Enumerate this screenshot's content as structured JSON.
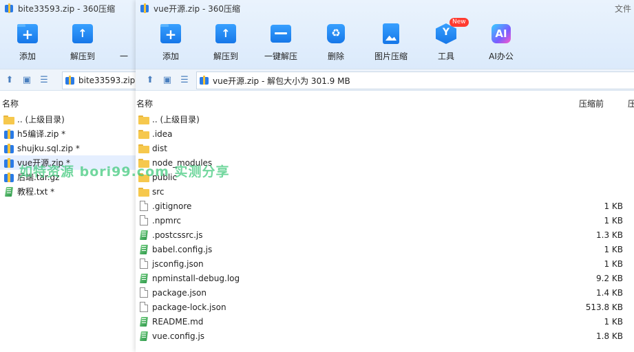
{
  "left_window": {
    "title": "bite33593.zip - 360压缩",
    "toolbar": {
      "add_label": "添加",
      "extract_label": "解压到",
      "overflow_label": "一"
    },
    "path": "bite33593.zip",
    "column_name": "名称",
    "files": [
      {
        "icon": "folder-icon",
        "name": ".. (上级目录)"
      },
      {
        "icon": "zip-icon",
        "name": "h5编译.zip *"
      },
      {
        "icon": "zip-icon",
        "name": "shujku.sql.zip *"
      },
      {
        "icon": "zip-icon",
        "name": "vue开源.zip *"
      },
      {
        "icon": "zip-icon",
        "name": "后端.tar.gz"
      },
      {
        "icon": "script-icon",
        "name": "教程.txt *"
      }
    ]
  },
  "right_window": {
    "title": "vue开源.zip - 360压缩",
    "title_right": "文件",
    "toolbar": {
      "add_label": "添加",
      "extract_label": "解压到",
      "oneclick_label": "一键解压",
      "delete_label": "删除",
      "image_label": "图片压缩",
      "tools_label": "工具",
      "tools_badge": "New",
      "ai_label": "AI办公",
      "ai_icon_text": "AI"
    },
    "path": "vue开源.zip - 解包大小为 301.9 MB",
    "columns": {
      "name": "名称",
      "compressed": "压缩前",
      "extra": "压"
    },
    "files": [
      {
        "icon": "folder-icon",
        "name": ".. (上级目录)",
        "size": ""
      },
      {
        "icon": "folder-icon",
        "name": ".idea",
        "size": ""
      },
      {
        "icon": "folder-icon",
        "name": "dist",
        "size": ""
      },
      {
        "icon": "folder-icon",
        "name": "node_modules",
        "size": ""
      },
      {
        "icon": "folder-icon",
        "name": "public",
        "size": ""
      },
      {
        "icon": "folder-icon",
        "name": "src",
        "size": ""
      },
      {
        "icon": "file-icon",
        "name": ".gitignore",
        "size": "1 KB"
      },
      {
        "icon": "file-icon",
        "name": ".npmrc",
        "size": "1 KB"
      },
      {
        "icon": "script-icon",
        "name": ".postcssrc.js",
        "size": "1.3 KB"
      },
      {
        "icon": "script-icon",
        "name": "babel.config.js",
        "size": "1 KB"
      },
      {
        "icon": "file-icon",
        "name": "jsconfig.json",
        "size": "1 KB"
      },
      {
        "icon": "script-icon",
        "name": "npminstall-debug.log",
        "size": "9.2 KB"
      },
      {
        "icon": "file-icon",
        "name": "package.json",
        "size": "1.4 KB"
      },
      {
        "icon": "file-icon",
        "name": "package-lock.json",
        "size": "513.8 KB"
      },
      {
        "icon": "script-icon",
        "name": "README.md",
        "size": "1 KB"
      },
      {
        "icon": "script-icon",
        "name": "vue.config.js",
        "size": "1.8 KB"
      }
    ]
  },
  "watermark": "如特资源 bori99.com 实测分享"
}
